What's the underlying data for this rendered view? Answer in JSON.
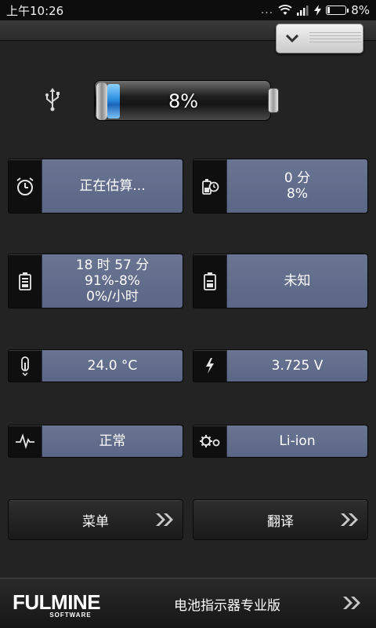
{
  "status_bar": {
    "time": "上午10:26",
    "signal_dots": "...",
    "battery_pct": "8%"
  },
  "header": {
    "collapse_icon": "chevron-down-icon"
  },
  "battery": {
    "level_pct": "8%",
    "level_fraction": 0.08,
    "charge_source_icon": "usb-icon"
  },
  "tiles": {
    "time_estimate": {
      "icon": "stopwatch-icon",
      "value": "正在估算..."
    },
    "discharge_time": {
      "icon": "battery-clock-icon",
      "line1": "0 分",
      "line2": "8%"
    },
    "history": {
      "icon": "battery-charge-icon",
      "line1": "18 时 57 分",
      "line2": "91%-8%",
      "line3": "0%/小时"
    },
    "capacity": {
      "icon": "battery-level-icon",
      "value": "未知"
    },
    "temperature": {
      "icon": "thermometer-icon",
      "value": "24.0 °C"
    },
    "voltage": {
      "icon": "bolt-icon",
      "value": "3.725 V"
    },
    "health": {
      "icon": "pulse-icon",
      "value": "正常"
    },
    "technology": {
      "icon": "gears-icon",
      "value": "Li-ion"
    }
  },
  "buttons": {
    "menu": "菜单",
    "translate": "翻译"
  },
  "footer": {
    "logo_text": "FULMINE",
    "logo_sub": "SOFTWARE",
    "app_title": "电池指示器专业版"
  }
}
